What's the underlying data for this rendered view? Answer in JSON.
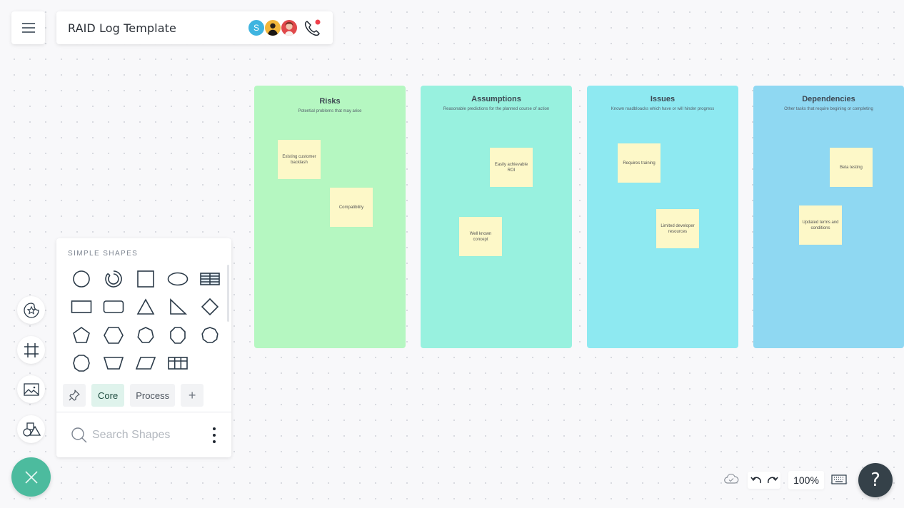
{
  "header": {
    "menu_icon": "hamburger-menu-icon",
    "title": "RAID Log Template",
    "collaborators": [
      {
        "initial": "S",
        "color": "#3fb4e0"
      },
      {
        "initial": "",
        "color": "#f3b63a"
      },
      {
        "initial": "",
        "color": "#e0484a"
      }
    ],
    "call_icon": "phone-call-icon",
    "call_badge_color": "#ef3f4a"
  },
  "board": {
    "columns": [
      {
        "title": "Risks",
        "subtitle": "Potential problems that may arise",
        "color": "#b5f7c1",
        "notes": [
          "Existing customer backlash",
          "Compatibility"
        ]
      },
      {
        "title": "Assumptions",
        "subtitle": "Reasonable predictions for the planned course of action",
        "color": "#98f1df",
        "notes": [
          "Easily achievable ROI",
          "Well known concept"
        ]
      },
      {
        "title": "Issues",
        "subtitle": "Known roadbloacks which have or will hinder progress",
        "color": "#8ee9f1",
        "notes": [
          "Requires training",
          "Limited developer resources"
        ]
      },
      {
        "title": "Dependencies",
        "subtitle": "Other tasks that require begining or completing",
        "color": "#8fd8f2",
        "notes": [
          "Beta testing",
          "Updated terms and conditions"
        ]
      }
    ],
    "note_color": "#fdf8c8"
  },
  "shapes_panel": {
    "heading": "SIMPLE SHAPES",
    "shapes": [
      "circle",
      "donut",
      "square",
      "ellipse",
      "table-striped",
      "rectangle",
      "rounded-rectangle",
      "triangle",
      "right-triangle",
      "diamond",
      "pentagon",
      "hexagon",
      "heptagon",
      "octagon",
      "nonagon",
      "decagon",
      "trapezoid",
      "parallelogram",
      "table-grid"
    ],
    "tabs": {
      "pin": "pin-icon",
      "core": "Core",
      "process": "Process",
      "add": "+"
    },
    "search_placeholder": "Search Shapes"
  },
  "left_toolbar": {
    "items": [
      "sticker-icon",
      "frame-icon",
      "image-icon",
      "shapes-icon"
    ],
    "fab": "close-icon",
    "fab_color": "#4cbb9e"
  },
  "bottom_bar": {
    "save_status": "cloud-saved-icon",
    "zoom_level": "100%",
    "help_label": "?"
  }
}
